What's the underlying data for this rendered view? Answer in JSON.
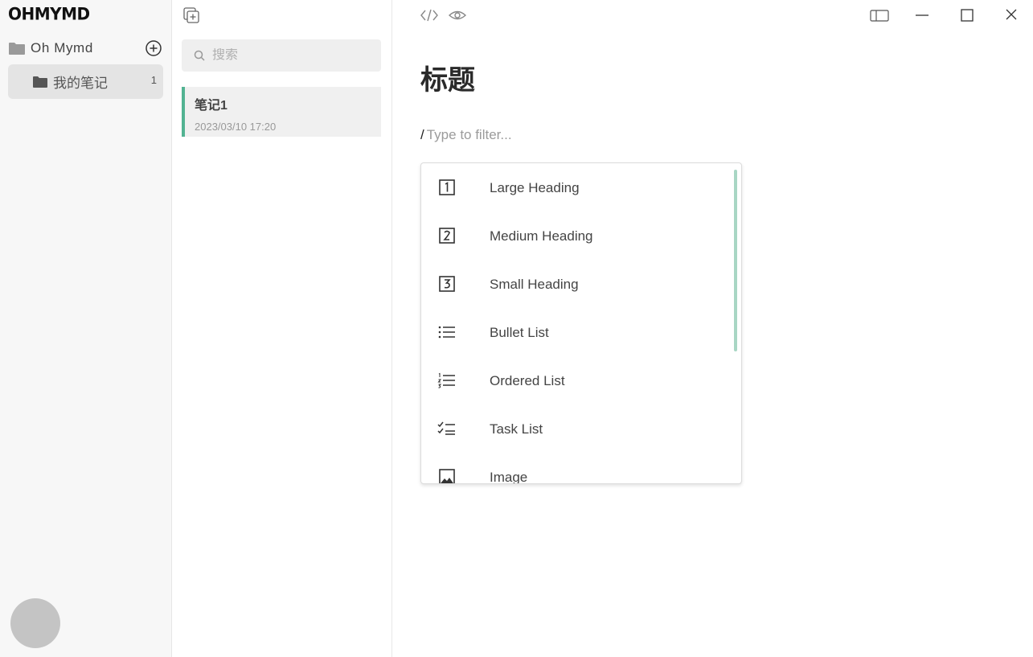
{
  "sidebar": {
    "logo": "OHMYMD",
    "workspace": "Oh Mymd",
    "folders": [
      {
        "label": "我的笔记",
        "count": "1"
      }
    ]
  },
  "notelist": {
    "search_placeholder": "搜索",
    "notes": [
      {
        "title": "笔记1",
        "date": "2023/03/10 17:20"
      }
    ]
  },
  "editor": {
    "title": "标题",
    "slash": "/",
    "filter_placeholder": "Type to filter...",
    "menu": [
      {
        "label": "Large Heading",
        "icon": "heading-1-icon"
      },
      {
        "label": "Medium Heading",
        "icon": "heading-2-icon"
      },
      {
        "label": "Small Heading",
        "icon": "heading-3-icon"
      },
      {
        "label": "Bullet List",
        "icon": "bullet-list-icon"
      },
      {
        "label": "Ordered List",
        "icon": "ordered-list-icon"
      },
      {
        "label": "Task List",
        "icon": "task-list-icon"
      },
      {
        "label": "Image",
        "icon": "image-icon"
      }
    ]
  },
  "colors": {
    "accent": "#52b392",
    "scrollbar": "#a8d6c4",
    "sidebar_bg": "#f7f7f7",
    "selected_bg": "#e4e4e4"
  }
}
